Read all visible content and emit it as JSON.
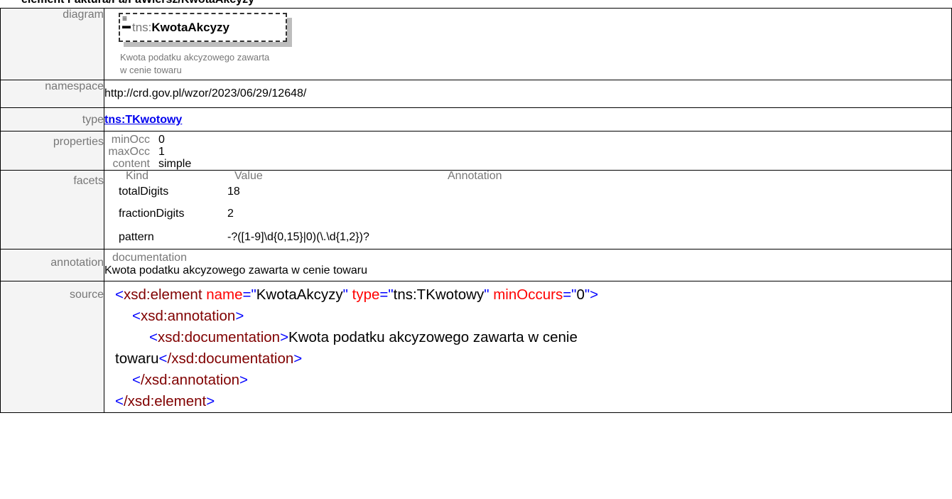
{
  "header": {
    "title": "element Faktura/Fa/FaWiersz/KwotaAkcyzy"
  },
  "labels": {
    "diagram": "diagram",
    "namespace": "namespace",
    "type": "type",
    "properties": "properties",
    "facets": "facets",
    "annotation": "annotation",
    "source": "source"
  },
  "diagram": {
    "element_prefix": "tns:",
    "element_name": "KwotaAkcyzy",
    "documentation": "Kwota podatku akcyzowego zawarta w cenie towaru"
  },
  "namespace": "http://crd.gov.pl/wzor/2023/06/29/12648/",
  "type": {
    "link_text": "tns:TKwotowy"
  },
  "properties": [
    {
      "key": "minOcc",
      "value": "0"
    },
    {
      "key": "maxOcc",
      "value": "1"
    },
    {
      "key": "content",
      "value": "simple"
    }
  ],
  "facets": {
    "columns": [
      "Kind",
      "Value",
      "Annotation"
    ],
    "rows": [
      {
        "kind": "totalDigits",
        "value": "18"
      },
      {
        "kind": "fractionDigits",
        "value": "2"
      },
      {
        "kind": "pattern",
        "value": "-?([1-9]\\d{0,15}|0)(\\.\\d{1,2})?"
      }
    ]
  },
  "annotation": {
    "heading": "documentation",
    "text": "Kwota podatku akcyzowego zawarta w cenie towaru"
  },
  "source": {
    "el_open": "xsd:element",
    "attr_name": "name",
    "attr_name_val": "KwotaAkcyzy",
    "attr_type": "type",
    "attr_type_val": "tns:TKwotowy",
    "attr_min": "minOccurs",
    "attr_min_val": "0",
    "ann_tag": "xsd:annotation",
    "doc_tag": "xsd:documentation",
    "doc_text_1": "Kwota podatku akcyzowego zawarta w cenie",
    "doc_text_2": "towaru",
    "doc_close": "/xsd:documentation",
    "ann_close": "/xsd:annotation",
    "el_close": "/xsd:element"
  }
}
